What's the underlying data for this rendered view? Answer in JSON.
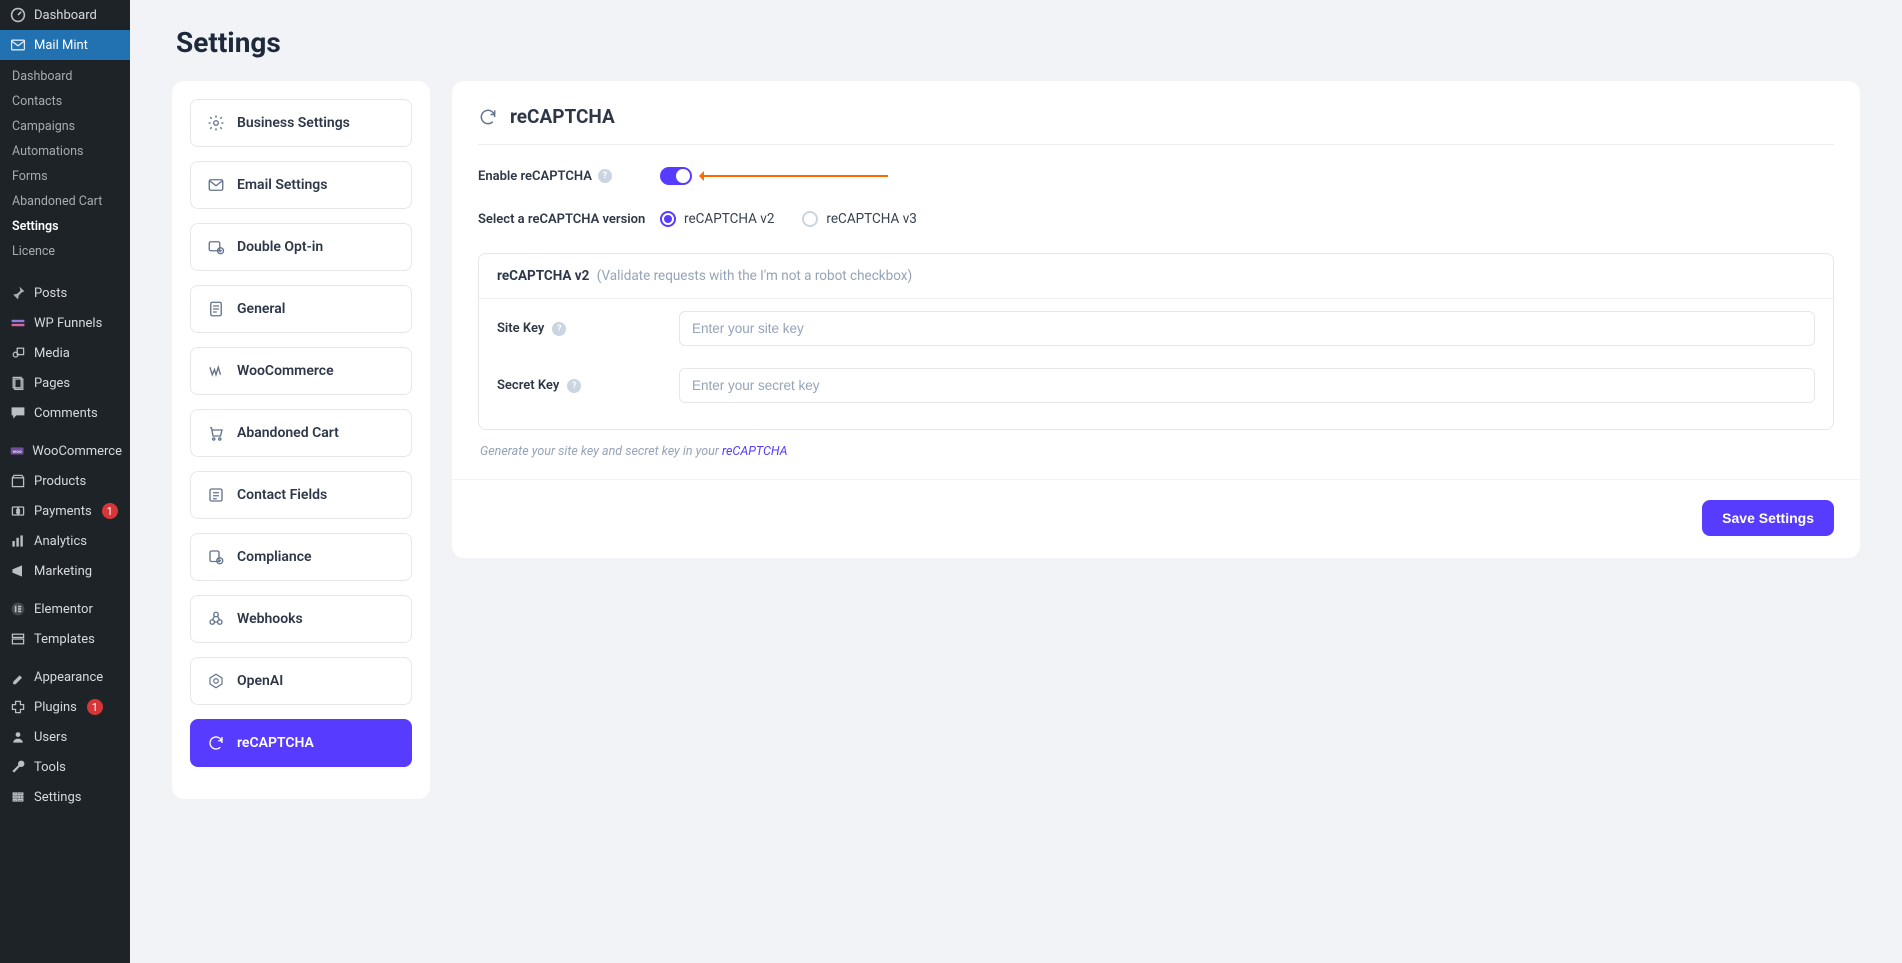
{
  "sidebar": {
    "items": [
      {
        "label": "Dashboard",
        "icon": "dashboard-icon"
      },
      {
        "label": "Mail Mint",
        "icon": "mail-icon",
        "active": true
      },
      {
        "label": "Posts",
        "icon": "pin-icon"
      },
      {
        "label": "WP Funnels",
        "icon": "funnel-icon"
      },
      {
        "label": "Media",
        "icon": "media-icon"
      },
      {
        "label": "Pages",
        "icon": "pages-icon"
      },
      {
        "label": "Comments",
        "icon": "comments-icon"
      },
      {
        "label": "WooCommerce",
        "icon": "woo-icon"
      },
      {
        "label": "Products",
        "icon": "products-icon"
      },
      {
        "label": "Payments",
        "icon": "payments-icon",
        "badge": "1"
      },
      {
        "label": "Analytics",
        "icon": "analytics-icon"
      },
      {
        "label": "Marketing",
        "icon": "marketing-icon"
      },
      {
        "label": "Elementor",
        "icon": "elementor-icon"
      },
      {
        "label": "Templates",
        "icon": "templates-icon"
      },
      {
        "label": "Appearance",
        "icon": "appearance-icon"
      },
      {
        "label": "Plugins",
        "icon": "plugins-icon",
        "badge": "1"
      },
      {
        "label": "Users",
        "icon": "users-icon"
      },
      {
        "label": "Tools",
        "icon": "tools-icon"
      },
      {
        "label": "Settings",
        "icon": "settings-icon"
      }
    ],
    "mailmint_sub": [
      {
        "label": "Dashboard"
      },
      {
        "label": "Contacts"
      },
      {
        "label": "Campaigns"
      },
      {
        "label": "Automations"
      },
      {
        "label": "Forms"
      },
      {
        "label": "Abandoned Cart"
      },
      {
        "label": "Settings",
        "current": true
      },
      {
        "label": "Licence"
      }
    ]
  },
  "page": {
    "title": "Settings",
    "save_label": "Save Settings"
  },
  "settings_nav": [
    {
      "label": "Business Settings",
      "icon": "gear-icon"
    },
    {
      "label": "Email Settings",
      "icon": "envelope-icon"
    },
    {
      "label": "Double Opt-in",
      "icon": "optin-icon"
    },
    {
      "label": "General",
      "icon": "doc-icon"
    },
    {
      "label": "WooCommerce",
      "icon": "woo-w-icon"
    },
    {
      "label": "Abandoned Cart",
      "icon": "cart-icon"
    },
    {
      "label": "Contact Fields",
      "icon": "fields-icon"
    },
    {
      "label": "Compliance",
      "icon": "shield-icon"
    },
    {
      "label": "Webhooks",
      "icon": "webhook-icon"
    },
    {
      "label": "OpenAI",
      "icon": "openai-icon"
    },
    {
      "label": "reCAPTCHA",
      "icon": "recaptcha-icon",
      "active": true
    }
  ],
  "panel": {
    "title": "reCAPTCHA",
    "enable_label": "Enable reCAPTCHA",
    "enable_value": true,
    "version_label": "Select a reCAPTCHA version",
    "version_options": [
      {
        "label": "reCAPTCHA v2",
        "selected": true
      },
      {
        "label": "reCAPTCHA v3",
        "selected": false
      }
    ],
    "box": {
      "heading": "reCAPTCHA v2",
      "hint": "(Validate requests with the I'm not a robot checkbox)",
      "fields": [
        {
          "label": "Site Key",
          "placeholder": "Enter your site key",
          "value": ""
        },
        {
          "label": "Secret Key",
          "placeholder": "Enter your secret key",
          "value": ""
        }
      ]
    },
    "foot_hint_prefix": "Generate your site key and secret key in your ",
    "foot_hint_link": "reCAPTCHA"
  },
  "colors": {
    "accent": "#573bff",
    "arrow": "#ff6a00",
    "sidebar_active": "#2271b1",
    "badge": "#d63638"
  }
}
